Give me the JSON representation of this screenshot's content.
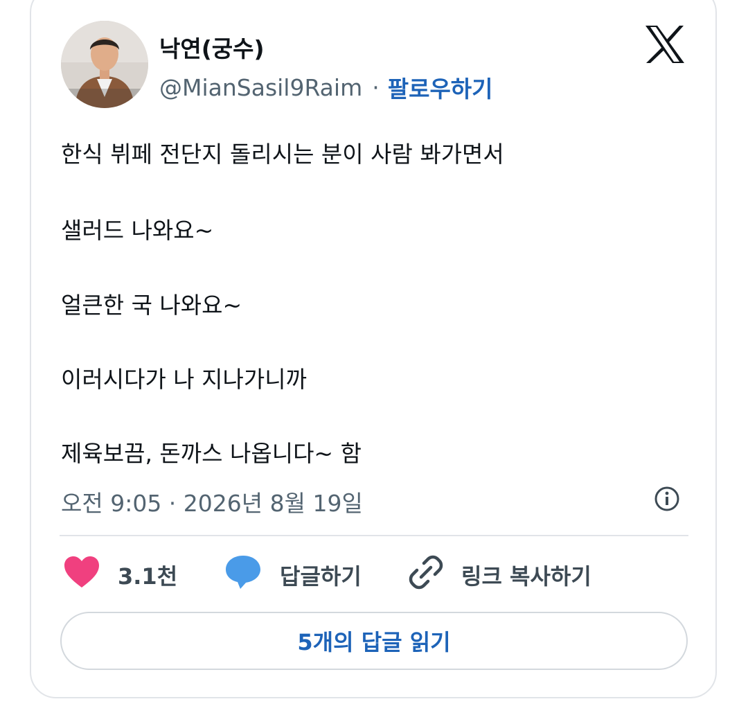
{
  "author": {
    "name": "낙연(궁수)",
    "handle": "@MianSasil9Raim",
    "separator": "·",
    "follow_label": "팔로우하기"
  },
  "icons": {
    "brand": "x-logo-icon",
    "info": "info-icon",
    "like": "heart-icon",
    "reply": "speech-bubble-icon",
    "copy_link": "link-icon"
  },
  "tweet": {
    "lines": [
      "한식 뷔페 전단지 돌리시는 분이 사람 봐가면서",
      "샐러드 나와요~",
      "얼큰한 국 나와요~",
      "이러시다가 나 지나가니까",
      "제육보끔, 돈까스 나옵니다~ 함"
    ],
    "timestamp": "오전 9:05 · 2026년 8월 19일"
  },
  "actions": {
    "like_count": "3.1천",
    "reply_label": "답글하기",
    "copy_link_label": "링크 복사하기"
  },
  "read_replies_label": "5개의 답글 읽기",
  "colors": {
    "accent": "#1d63b8",
    "like": "#f0407f",
    "reply": "#4a9be8",
    "secondary_text": "#536471",
    "border": "#e1e4e8"
  }
}
